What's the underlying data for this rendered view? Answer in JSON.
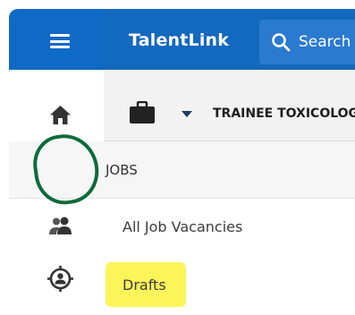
{
  "topbar": {
    "brand": "TalentLink",
    "search_placeholder": "Search",
    "menu_icon": "hamburger-icon",
    "search_icon": "search-icon"
  },
  "rail": {
    "items": [
      {
        "icon": "home-icon"
      },
      {
        "icon": "briefcase-icon"
      },
      {
        "icon": "people-icon"
      },
      {
        "icon": "target-person-icon"
      }
    ]
  },
  "subheader": {
    "icon": "briefcase-icon",
    "dropdown_icon": "caret-down-icon",
    "title": "TRAINEE TOXICOLOGIST"
  },
  "section": {
    "label": "JOBS"
  },
  "menu": {
    "items": [
      {
        "label": "All Job Vacancies"
      },
      {
        "label": "Drafts"
      }
    ]
  },
  "colors": {
    "primary": "#1368bf",
    "rail_top": "#0f6ac6",
    "annotation_circle": "#0d6b3b",
    "highlight": "#fbf55a"
  }
}
